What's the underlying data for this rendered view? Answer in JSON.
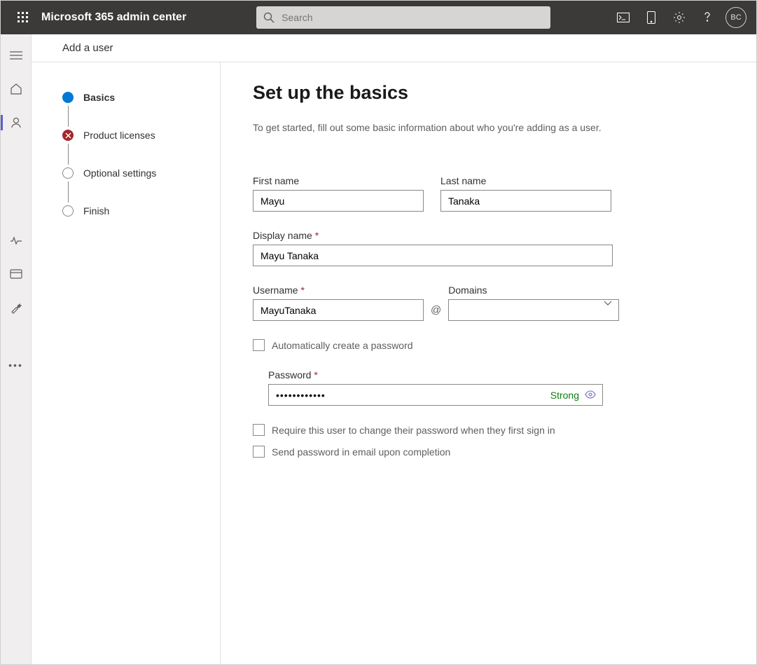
{
  "header": {
    "app_title": "Microsoft 365 admin center",
    "search_placeholder": "Search",
    "avatar_initials": "BC"
  },
  "page": {
    "breadcrumb": "Add a user"
  },
  "wizard": {
    "steps": {
      "basics": "Basics",
      "licenses": "Product licenses",
      "optional": "Optional settings",
      "finish": "Finish"
    }
  },
  "form": {
    "title": "Set up the basics",
    "intro": "To get started, fill out some basic information about who you're adding as a user.",
    "labels": {
      "first_name": "First name",
      "last_name": "Last name",
      "display_name": "Display name",
      "username": "Username",
      "domains": "Domains",
      "password": "Password"
    },
    "values": {
      "first_name": "Mayu",
      "last_name": "Tanaka",
      "display_name": "Mayu Tanaka",
      "username": "MayuTanaka",
      "domain": "",
      "password": "••••••••••••",
      "password_strength": "Strong"
    },
    "checkboxes": {
      "auto_pw": "Automatically create a password",
      "require_change": "Require this user to change their password when they first sign in",
      "send_email": "Send password in email upon completion"
    }
  }
}
